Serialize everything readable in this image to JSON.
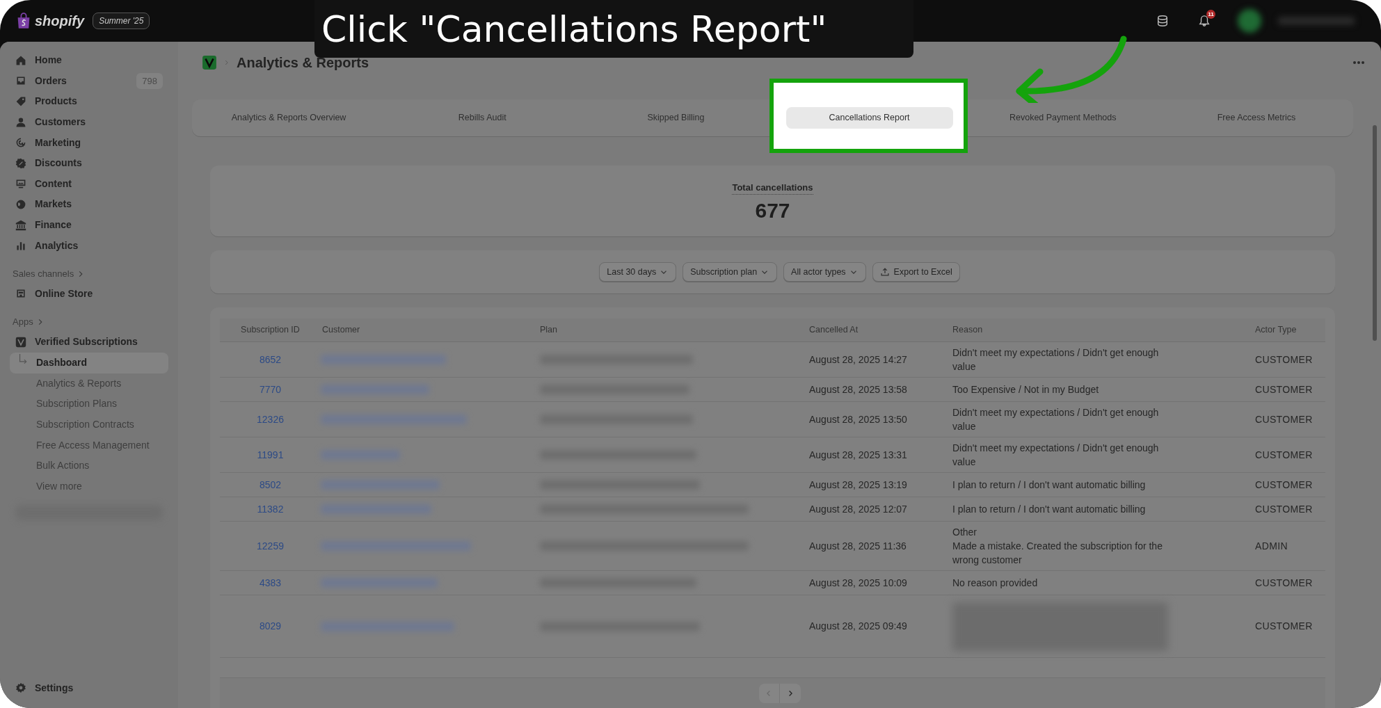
{
  "guide": {
    "caption": "Click \"Cancellations Report\""
  },
  "topbar": {
    "brand": "shopify",
    "edition": "Summer '25",
    "notifications": "11"
  },
  "sidebar": {
    "items": [
      {
        "kind": "home",
        "label": "Home"
      },
      {
        "kind": "orders",
        "label": "Orders",
        "badge": "798"
      },
      {
        "kind": "products",
        "label": "Products"
      },
      {
        "kind": "customers",
        "label": "Customers"
      },
      {
        "kind": "marketing",
        "label": "Marketing"
      },
      {
        "kind": "discounts",
        "label": "Discounts"
      },
      {
        "kind": "content",
        "label": "Content"
      },
      {
        "kind": "markets",
        "label": "Markets"
      },
      {
        "kind": "finance",
        "label": "Finance"
      },
      {
        "kind": "analytics",
        "label": "Analytics"
      }
    ],
    "sales_channels": {
      "heading": "Sales channels",
      "items": [
        {
          "label": "Online Store"
        }
      ]
    },
    "apps": {
      "heading": "Apps",
      "app": "Verified Subscriptions",
      "items": [
        {
          "label": "Dashboard",
          "selected": true
        },
        {
          "label": "Analytics & Reports",
          "selected": false
        },
        {
          "label": "Subscription Plans",
          "selected": false
        },
        {
          "label": "Subscription Contracts",
          "selected": false
        },
        {
          "label": "Free Access Management",
          "selected": false
        },
        {
          "label": "Bulk Actions",
          "selected": false
        },
        {
          "label": "View more",
          "selected": false
        }
      ]
    },
    "settings": "Settings"
  },
  "page": {
    "title": "Analytics & Reports",
    "tabs": [
      {
        "label": "Analytics & Reports Overview",
        "selected": false
      },
      {
        "label": "Rebills Audit",
        "selected": false
      },
      {
        "label": "Skipped Billing",
        "selected": false
      },
      {
        "label": "Cancellations Report",
        "selected": true
      },
      {
        "label": "Revoked Payment Methods",
        "selected": false
      },
      {
        "label": "Free Access Metrics",
        "selected": false
      }
    ],
    "total": {
      "label": "Total cancellations",
      "value": "677"
    },
    "filters": [
      "Last 30 days",
      "Subscription plan",
      "All actor types"
    ],
    "export": "Export to Excel",
    "table": {
      "columns": [
        "Subscription ID",
        "Customer",
        "Plan",
        "Cancelled At",
        "Reason",
        "Actor Type"
      ],
      "rows": [
        {
          "id": "8652",
          "cancelled_at": "August 28, 2025 14:27",
          "reason": [
            "Didn't meet my expectations / Didn't get enough value"
          ],
          "actor": "CUSTOMER"
        },
        {
          "id": "7770",
          "cancelled_at": "August 28, 2025 13:58",
          "reason": [
            "Too Expensive / Not in my Budget"
          ],
          "actor": "CUSTOMER"
        },
        {
          "id": "12326",
          "cancelled_at": "August 28, 2025 13:50",
          "reason": [
            "Didn't meet my expectations / Didn't get enough value"
          ],
          "actor": "CUSTOMER"
        },
        {
          "id": "11991",
          "cancelled_at": "August 28, 2025 13:31",
          "reason": [
            "Didn't meet my expectations / Didn't get enough value"
          ],
          "actor": "CUSTOMER"
        },
        {
          "id": "8502",
          "cancelled_at": "August 28, 2025 13:19",
          "reason": [
            "I plan to return / I don't want automatic billing"
          ],
          "actor": "CUSTOMER"
        },
        {
          "id": "11382",
          "cancelled_at": "August 28, 2025 12:07",
          "reason": [
            "I plan to return / I don't want automatic billing"
          ],
          "actor": "CUSTOMER"
        },
        {
          "id": "12259",
          "cancelled_at": "August 28, 2025 11:36",
          "reason": [
            "Other",
            "Made a mistake. Created the subscription for the wrong customer"
          ],
          "actor": "ADMIN"
        },
        {
          "id": "4383",
          "cancelled_at": "August 28, 2025 10:09",
          "reason": [
            "No reason provided"
          ],
          "actor": "CUSTOMER"
        },
        {
          "id": "8029",
          "cancelled_at": "August 28, 2025 09:49",
          "actor": "CUSTOMER"
        }
      ]
    }
  }
}
